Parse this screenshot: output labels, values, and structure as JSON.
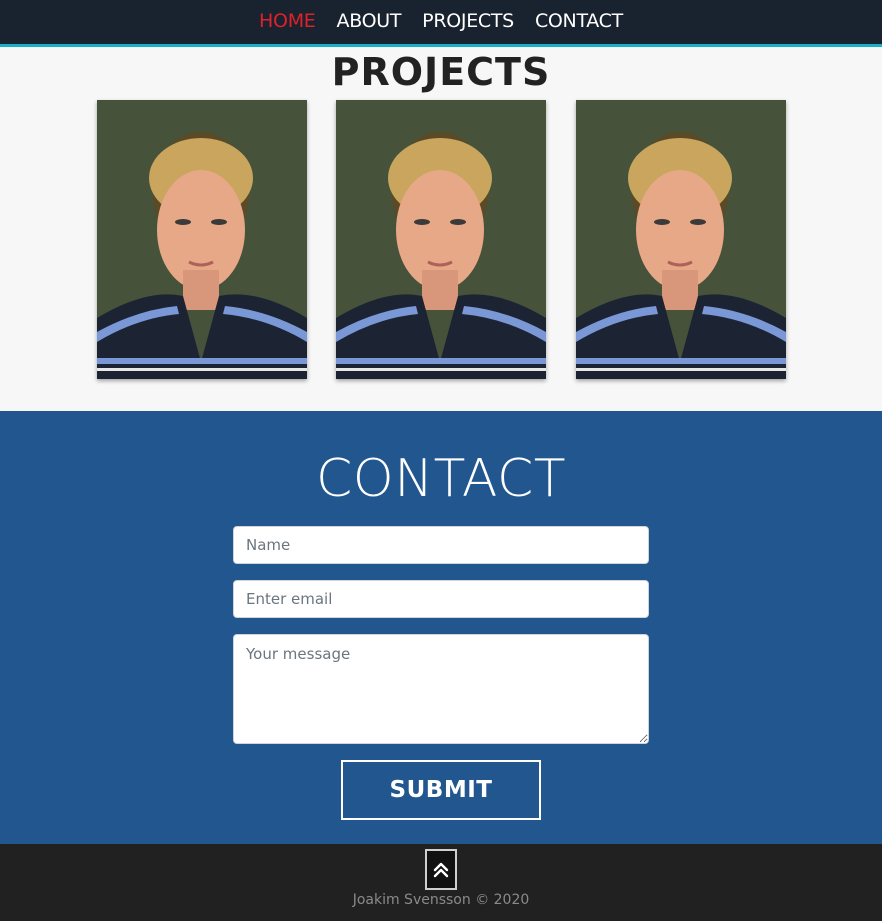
{
  "nav": {
    "items": [
      {
        "label": "HOME",
        "active": true
      },
      {
        "label": "ABOUT",
        "active": false
      },
      {
        "label": "PROJECTS",
        "active": false
      },
      {
        "label": "CONTACT",
        "active": false
      }
    ]
  },
  "projects": {
    "title": "PROJECTS",
    "cards": [
      {
        "image": "portrait-photo"
      },
      {
        "image": "portrait-photo"
      },
      {
        "image": "portrait-photo"
      }
    ]
  },
  "contact": {
    "title": "CONTACT",
    "name_placeholder": "Name",
    "email_placeholder": "Enter email",
    "message_placeholder": "Your message",
    "submit_label": "SUBMIT"
  },
  "footer": {
    "back_to_top_icon": "double-chevron-up-icon",
    "copyright": "Joakim Svensson © 2020"
  },
  "colors": {
    "nav_bg": "#19222f",
    "nav_accent": "#18b0c8",
    "active_link": "#e0212b",
    "contact_bg": "#22568e",
    "footer_bg": "#212121"
  }
}
